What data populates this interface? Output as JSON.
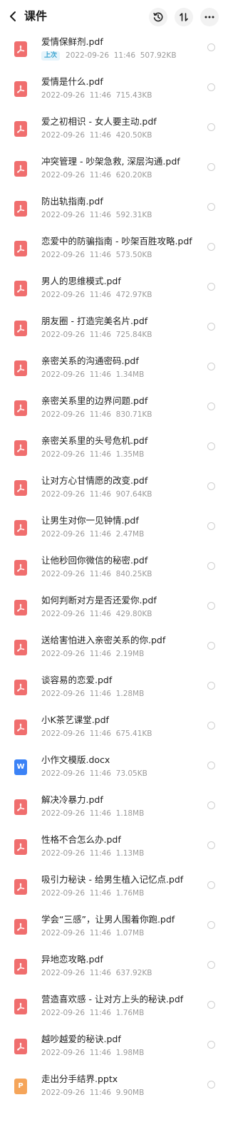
{
  "header": {
    "title": "课件",
    "back_icon": "chevron-left-icon",
    "history_icon": "history-clock-icon",
    "sort_icon": "sort-arrows-icon",
    "more_icon": "more-dots-icon"
  },
  "colors": {
    "pdf": "#f06e6e",
    "docx": "#3b82f6",
    "pptx": "#f5a55a",
    "badge": "#3aa3d0"
  },
  "files": [
    {
      "name": "爱情保鲜剂.pdf",
      "type": "pdf",
      "date": "2022-09-26",
      "time": "11:46",
      "size": "507.92KB",
      "badge": "上次"
    },
    {
      "name": "爱情是什么.pdf",
      "type": "pdf",
      "date": "2022-09-26",
      "time": "11:46",
      "size": "715.43KB"
    },
    {
      "name": "爱之初相识 - 女人要主动.pdf",
      "type": "pdf",
      "date": "2022-09-26",
      "time": "11:46",
      "size": "420.50KB"
    },
    {
      "name": "冲突管理 - 吵架急救, 深层沟通.pdf",
      "type": "pdf",
      "date": "2022-09-26",
      "time": "11:46",
      "size": "620.20KB"
    },
    {
      "name": "防出轨指南.pdf",
      "type": "pdf",
      "date": "2022-09-26",
      "time": "11:46",
      "size": "592.31KB"
    },
    {
      "name": "恋爱中的防骗指南 - 吵架百胜攻略.pdf",
      "type": "pdf",
      "date": "2022-09-26",
      "time": "11:46",
      "size": "573.50KB"
    },
    {
      "name": "男人的思维模式.pdf",
      "type": "pdf",
      "date": "2022-09-26",
      "time": "11:46",
      "size": "472.97KB"
    },
    {
      "name": "朋友圈 - 打造完美名片.pdf",
      "type": "pdf",
      "date": "2022-09-26",
      "time": "11:46",
      "size": "725.84KB"
    },
    {
      "name": "亲密关系的沟通密码.pdf",
      "type": "pdf",
      "date": "2022-09-26",
      "time": "11:46",
      "size": "1.34MB"
    },
    {
      "name": "亲密关系里的边界问题.pdf",
      "type": "pdf",
      "date": "2022-09-26",
      "time": "11:46",
      "size": "830.71KB"
    },
    {
      "name": "亲密关系里的头号危机.pdf",
      "type": "pdf",
      "date": "2022-09-26",
      "time": "11:46",
      "size": "1.35MB"
    },
    {
      "name": "让对方心甘情愿的改变.pdf",
      "type": "pdf",
      "date": "2022-09-26",
      "time": "11:46",
      "size": "907.64KB"
    },
    {
      "name": "让男生对你一见钟情.pdf",
      "type": "pdf",
      "date": "2022-09-26",
      "time": "11:46",
      "size": "2.47MB"
    },
    {
      "name": "让他秒回你微信的秘密.pdf",
      "type": "pdf",
      "date": "2022-09-26",
      "time": "11:46",
      "size": "840.25KB"
    },
    {
      "name": "如何判断对方是否还爱你.pdf",
      "type": "pdf",
      "date": "2022-09-26",
      "time": "11:46",
      "size": "429.80KB"
    },
    {
      "name": "送给害怕进入亲密关系的你.pdf",
      "type": "pdf",
      "date": "2022-09-26",
      "time": "11:46",
      "size": "2.19MB"
    },
    {
      "name": "谈容易的恋爱.pdf",
      "type": "pdf",
      "date": "2022-09-26",
      "time": "11:46",
      "size": "1.28MB"
    },
    {
      "name": "小K茶艺课堂.pdf",
      "type": "pdf",
      "date": "2022-09-26",
      "time": "11:46",
      "size": "675.41KB"
    },
    {
      "name": "小作文模版.docx",
      "type": "docx",
      "letter": "W",
      "date": "2022-09-26",
      "time": "11:46",
      "size": "73.05KB"
    },
    {
      "name": "解决冷暴力.pdf",
      "type": "pdf",
      "date": "2022-09-26",
      "time": "11:46",
      "size": "1.18MB"
    },
    {
      "name": "性格不合怎么办.pdf",
      "type": "pdf",
      "date": "2022-09-26",
      "time": "11:46",
      "size": "1.13MB"
    },
    {
      "name": "吸引力秘诀 - 给男生植入记忆点.pdf",
      "type": "pdf",
      "date": "2022-09-26",
      "time": "11:46",
      "size": "1.76MB"
    },
    {
      "name": "学会“三感”，让男人围着你跑.pdf",
      "type": "pdf",
      "date": "2022-09-26",
      "time": "11:46",
      "size": "1.07MB"
    },
    {
      "name": "异地恋攻略.pdf",
      "type": "pdf",
      "date": "2022-09-26",
      "time": "11:46",
      "size": "637.92KB"
    },
    {
      "name": "营造喜欢感 - 让对方上头的秘诀.pdf",
      "type": "pdf",
      "date": "2022-09-26",
      "time": "11:46",
      "size": "1.76MB"
    },
    {
      "name": "越吵越爱的秘诀.pdf",
      "type": "pdf",
      "date": "2022-09-26",
      "time": "11:46",
      "size": "1.98MB"
    },
    {
      "name": "走出分手结界.pptx",
      "type": "pptx",
      "letter": "P",
      "date": "2022-09-26",
      "time": "11:46",
      "size": "9.90MB"
    }
  ]
}
